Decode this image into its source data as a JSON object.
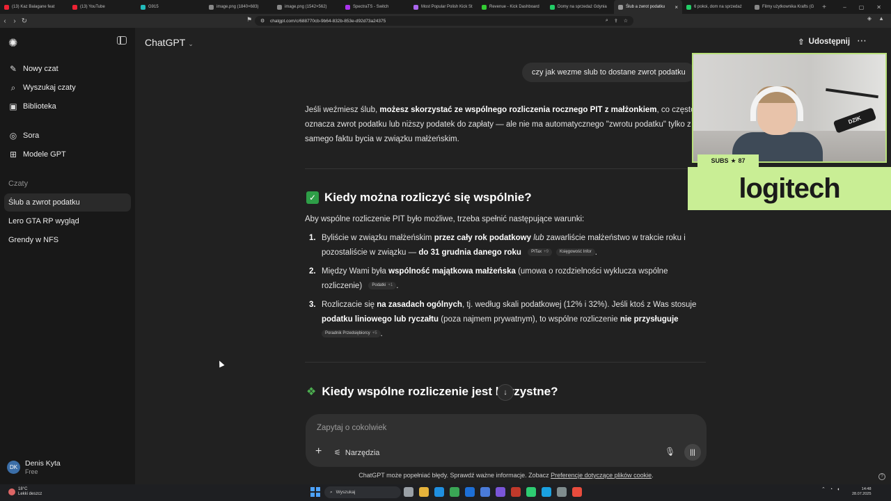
{
  "browser": {
    "tabs": [
      {
        "title": "(13) Kaz Balagane feat",
        "color": "#e23"
      },
      {
        "title": "(13) YouTube",
        "color": "#e23"
      },
      {
        "title": "G915",
        "color": "#2bb"
      },
      {
        "title": "image.png (1840×683)",
        "color": "#888"
      },
      {
        "title": "image.png (1542×562)",
        "color": "#888"
      },
      {
        "title": "SpectraTS - Switch",
        "color": "#a3e"
      },
      {
        "title": "Most Popular Polish Kick St",
        "color": "#a6e"
      },
      {
        "title": "Revenue - Kick Dashboard",
        "color": "#3c3"
      },
      {
        "title": "Domy na sprzedaż Gdynia",
        "color": "#2c6"
      },
      {
        "title": "Ślub a zwrot podatku",
        "color": "#999",
        "active": true
      },
      {
        "title": "6 pokoi, dom na sprzedaż",
        "color": "#2c6"
      },
      {
        "title": "Filmy użytkownika Krafts (G",
        "color": "#888"
      }
    ],
    "new_tab": "+",
    "url": "chatgpt.com/c/688770cb-9b64-832b-853e-d92d73a24375"
  },
  "sidebar": {
    "items": [
      {
        "label": "Nowy czat",
        "icon": "edit-icon"
      },
      {
        "label": "Wyszukaj czaty",
        "icon": "search-icon"
      },
      {
        "label": "Biblioteka",
        "icon": "library-icon"
      },
      {
        "label": "Sora",
        "icon": "sora-icon"
      },
      {
        "label": "Modele GPT",
        "icon": "grid-icon"
      }
    ],
    "section_label": "Czaty",
    "chats": [
      "Ślub a zwrot podatku",
      "Lero GTA RP wygląd",
      "Grendy w NFS"
    ],
    "user": {
      "initials": "DK",
      "name": "Denis Kyta",
      "plan": "Free"
    }
  },
  "header": {
    "model": "ChatGPT",
    "share": "Udostępnij"
  },
  "chat": {
    "user_message": "czy jak wezme slub to dostane zwrot podatku",
    "intro_1": "Jeśli weźmiesz ślub, ",
    "intro_b": "możesz skorzystać ze wspólnego rozliczenia rocznego PIT z małżonkiem",
    "intro_2": ", co często oznacza zwrot podatku lub niższy podatek do zapłaty — ale nie ma automatycznego \"zwrotu podatku\" tylko z samego faktu bycia w związku małżeńskim.",
    "h1": "Kiedy można rozliczyć się wspólnie?",
    "lead": "Aby wspólne rozliczenie PIT było możliwe, trzeba spełnić następujące warunki:",
    "li1": {
      "num": "1.",
      "a": "Byliście w związku małżeńskim ",
      "b": "przez cały rok podatkowy",
      "c": " ",
      "i": "lub",
      "d": " zawarliście małżeństwo w trakcie roku i pozostaliście w związku — ",
      "e": "do 31 grudnia danego roku",
      "chip1": "PITax",
      "chip1_count": "+9",
      "chip2": "Księgowość Infor",
      "end": "."
    },
    "li2": {
      "num": "2.",
      "a": "Między Wami była ",
      "b": "wspólność majątkowa małżeńska",
      "c": " (umowa o rozdzielności wyklucza wspólne rozliczenie)",
      "chip": "Podatki",
      "chip_count": "+1",
      "end": "."
    },
    "li3": {
      "num": "3.",
      "a": "Rozliczacie się ",
      "b": "na zasadach ogólnych",
      "c": ", tj. według skali podatkowej (12% i 32%). Jeśli ktoś z Was stosuje ",
      "d": "podatku liniowego lub ryczałtu",
      "e": " (poza najmem prywatnym), to wspólne rozliczenie ",
      "f": "nie przysługuje",
      "chip": "Poradnik Przedsiębiorcy",
      "chip_count": "+5",
      "end": "."
    },
    "h2": "Kiedy wspólne rozliczenie jest korzystne?",
    "scroll_icon": "arrow-down-icon"
  },
  "composer": {
    "placeholder": "Zapytaj o cokolwiek",
    "tools": "Narzędzia"
  },
  "footer": {
    "text": "ChatGPT może popełniać błędy. Sprawdź ważne informacje. Zobacz ",
    "link": "Preferencje dotyczące plików cookie",
    "end": ".",
    "help": "?"
  },
  "overlay": {
    "subs_label": "SUBS",
    "subs_count": "87",
    "brand": "logitech",
    "mic_brand": "DZIK"
  },
  "taskbar": {
    "temp": "18°C",
    "weather": "Lekki deszcz",
    "search": "Wyszukaj",
    "time": "14:48",
    "date": "28.07.2025"
  },
  "colors": {
    "accent_green": "#c9ee95",
    "check_green": "#2e9e47",
    "bg": "#212121",
    "sidebar_bg": "#181818"
  }
}
